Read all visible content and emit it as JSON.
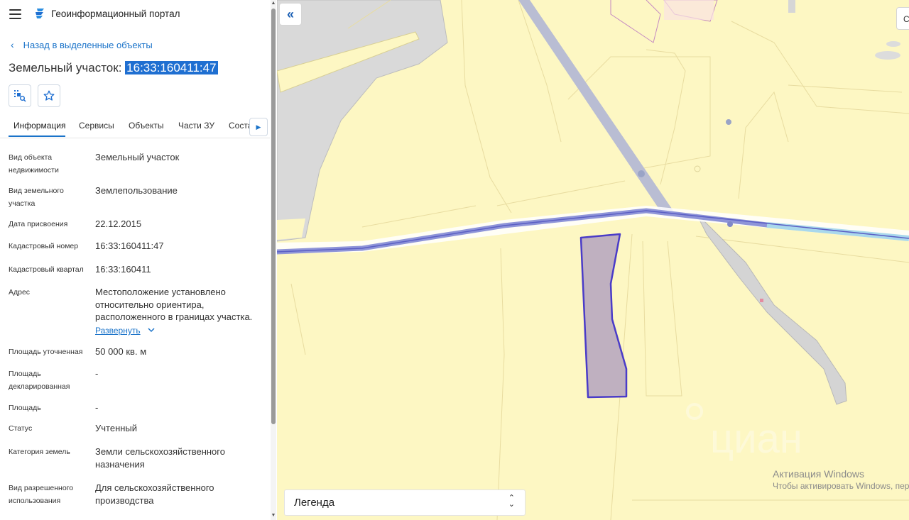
{
  "header": {
    "app_title": "Геоинформационный портал",
    "menu_icon": "hamburger-icon",
    "logo_icon": "portal-logo-icon"
  },
  "nav": {
    "back_label": "Назад в выделенные объекты"
  },
  "object": {
    "title_prefix": "Земельный участок:",
    "title_number": "16:33:160411:47"
  },
  "actions": {
    "icons": [
      "locate-on-map-icon",
      "star-icon"
    ]
  },
  "tabs": [
    {
      "label": "Информация",
      "active": true
    },
    {
      "label": "Сервисы"
    },
    {
      "label": "Объекты"
    },
    {
      "label": "Части ЗУ"
    },
    {
      "label": "Соста"
    }
  ],
  "details": [
    {
      "label": "Вид объекта недвижимости",
      "value": "Земельный участок"
    },
    {
      "label": "Вид земельного участка",
      "value": "Землепользование"
    },
    {
      "label": "Дата присвоения",
      "value": "22.12.2015"
    },
    {
      "label": "Кадастровый номер",
      "value": "16:33:160411:47"
    },
    {
      "label": "Кадастровый квартал",
      "value": "16:33:160411"
    },
    {
      "label": "Адрес",
      "value": "Местоположение установлено относительно ориентира, расположенного в границах участка."
    },
    {
      "label": "Площадь уточненная",
      "value": "50 000 кв. м"
    },
    {
      "label": "Площадь декларированная",
      "value": "-"
    },
    {
      "label": "Площадь",
      "value": "-"
    },
    {
      "label": "Статус",
      "value": "Учтенный"
    },
    {
      "label": "Категория земель",
      "value": "Земли сельскохозяйственного назначения"
    },
    {
      "label": "Вид разрешенного использования",
      "value": "Для сельскохозяйственного производства"
    }
  ],
  "expand_label": "Развернуть",
  "map": {
    "collapse_icon": "double-chevron-left-icon",
    "right_control_label": "С",
    "legend_label": "Легенда",
    "watermark": "циан",
    "colors": {
      "background": "#fdf7c3",
      "parcel_fill": "#bfb0c0",
      "parcel_stroke": "#4a3cc8",
      "road": "#b8bdd4"
    }
  },
  "windows_activation": {
    "line1": "Активация Windows",
    "line2": "Чтобы активировать Windows, пере"
  }
}
